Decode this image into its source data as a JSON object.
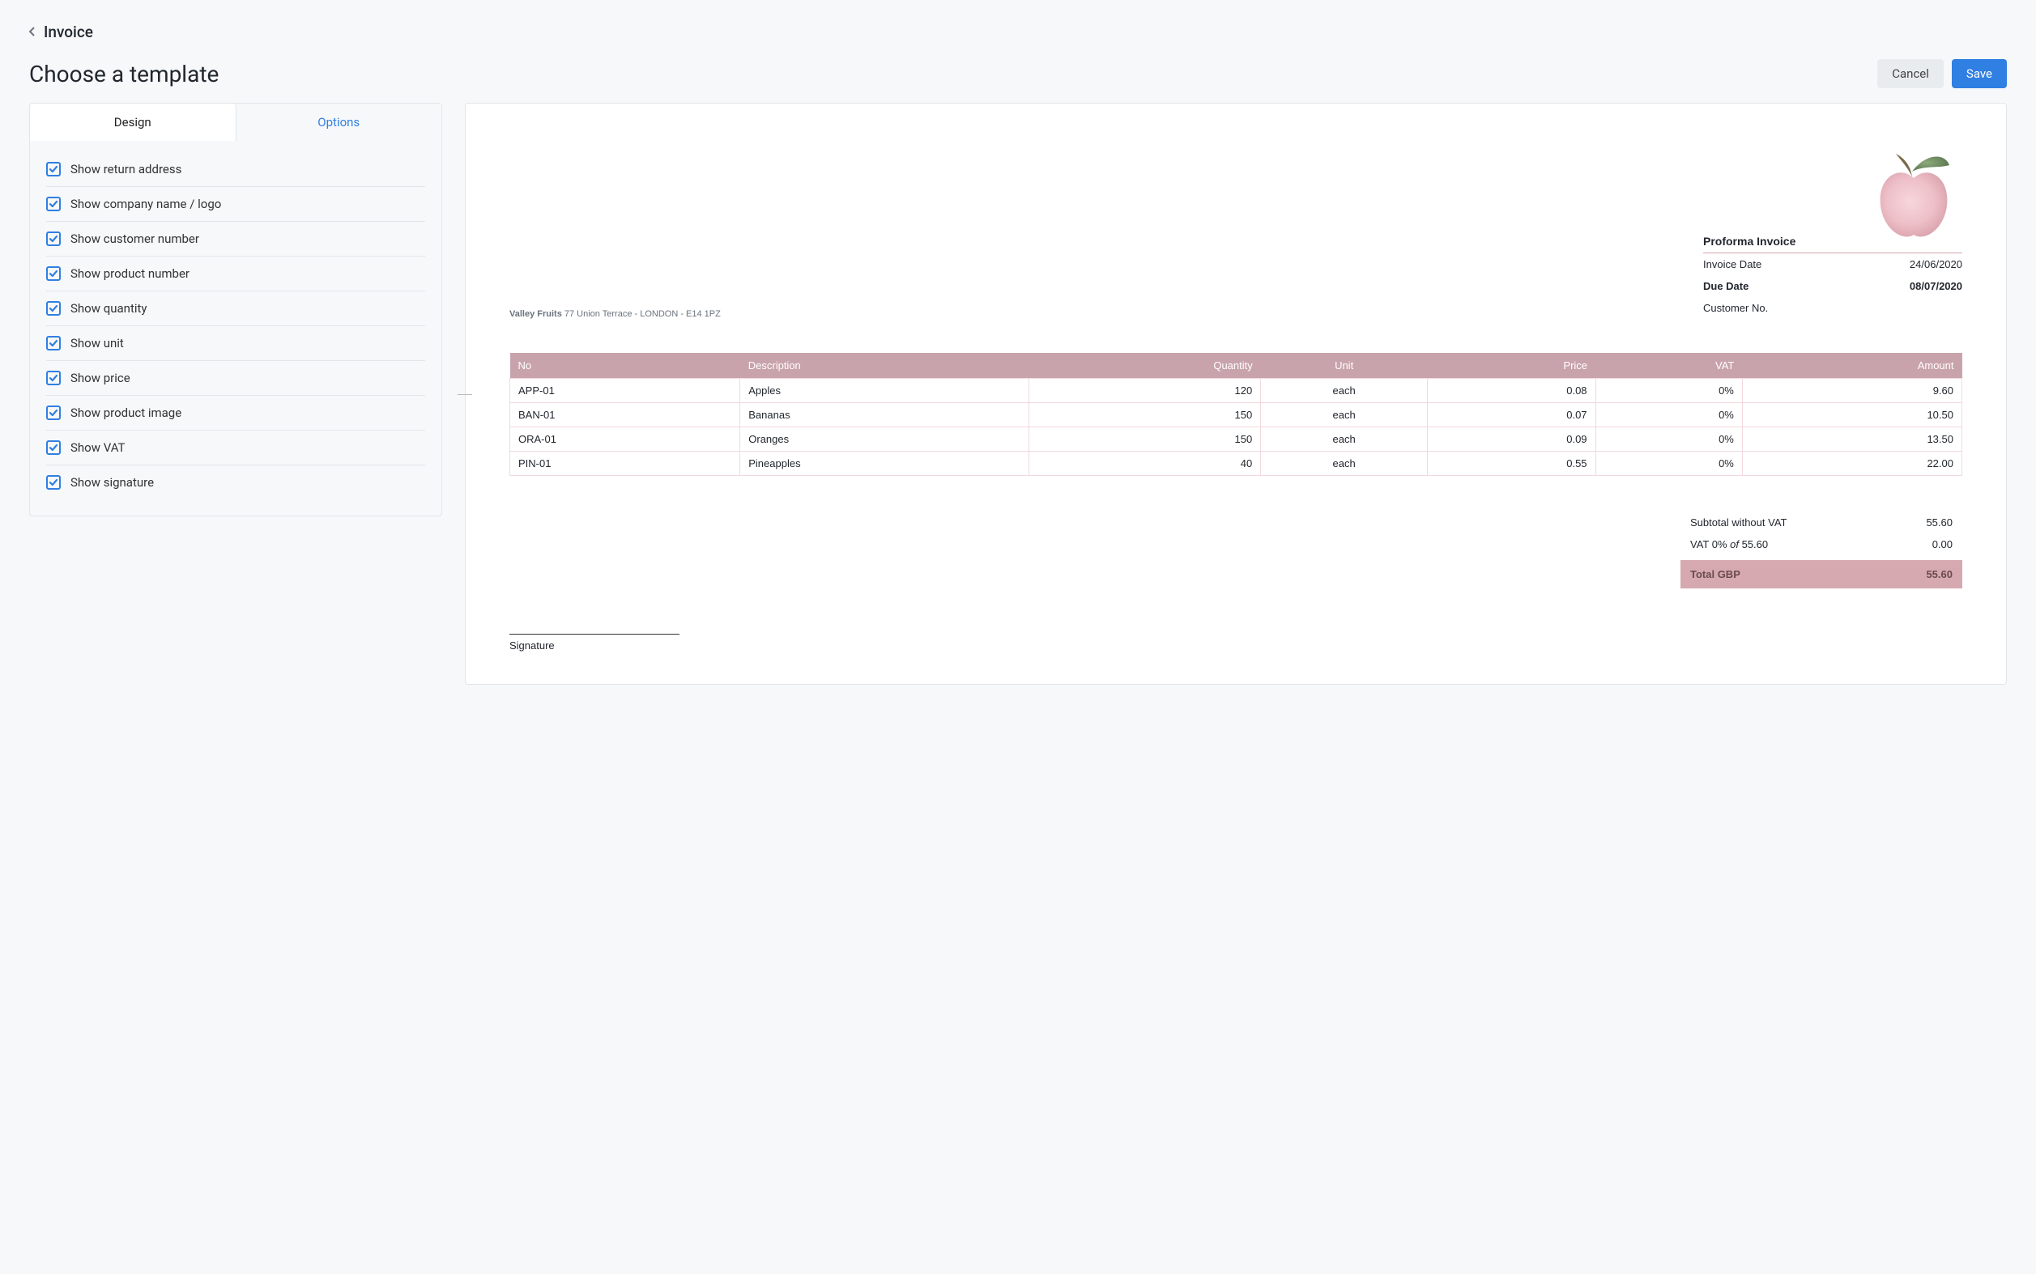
{
  "breadcrumb": {
    "back_label": "Invoice"
  },
  "header": {
    "title": "Choose a template"
  },
  "actions": {
    "cancel": "Cancel",
    "save": "Save"
  },
  "tabs": {
    "design": "Design",
    "options": "Options"
  },
  "options": {
    "items": [
      {
        "label": "Show return address"
      },
      {
        "label": "Show company name / logo"
      },
      {
        "label": "Show customer number"
      },
      {
        "label": "Show product number"
      },
      {
        "label": "Show quantity"
      },
      {
        "label": "Show unit"
      },
      {
        "label": "Show price"
      },
      {
        "label": "Show product image"
      },
      {
        "label": "Show VAT"
      },
      {
        "label": "Show signature"
      }
    ]
  },
  "invoice": {
    "sender": {
      "company": "Valley Fruits",
      "address": "77 Union Terrace - LONDON - E14 1PZ"
    },
    "title": "Proforma Invoice",
    "meta": {
      "invoice_date_label": "Invoice Date",
      "invoice_date": "24/06/2020",
      "due_date_label": "Due Date",
      "due_date": "08/07/2020",
      "customer_no_label": "Customer No."
    },
    "columns": {
      "no": "No",
      "desc": "Description",
      "qty": "Quantity",
      "unit": "Unit",
      "price": "Price",
      "vat": "VAT",
      "amount": "Amount"
    },
    "lines": [
      {
        "no": "APP-01",
        "desc": "Apples",
        "qty": "120",
        "unit": "each",
        "price": "0.08",
        "vat": "0%",
        "amount": "9.60"
      },
      {
        "no": "BAN-01",
        "desc": "Bananas",
        "qty": "150",
        "unit": "each",
        "price": "0.07",
        "vat": "0%",
        "amount": "10.50"
      },
      {
        "no": "ORA-01",
        "desc": "Oranges",
        "qty": "150",
        "unit": "each",
        "price": "0.09",
        "vat": "0%",
        "amount": "13.50"
      },
      {
        "no": "PIN-01",
        "desc": "Pineapples",
        "qty": "40",
        "unit": "each",
        "price": "0.55",
        "vat": "0%",
        "amount": "22.00"
      }
    ],
    "totals": {
      "subtotal_label": "Subtotal without VAT",
      "subtotal": "55.60",
      "vat_label_prefix": "VAT 0% ",
      "vat_label_italic": "of",
      "vat_label_suffix": " 55.60",
      "vat_amount": "0.00",
      "total_label": "Total GBP",
      "total": "55.60"
    },
    "signature_label": "Signature"
  }
}
